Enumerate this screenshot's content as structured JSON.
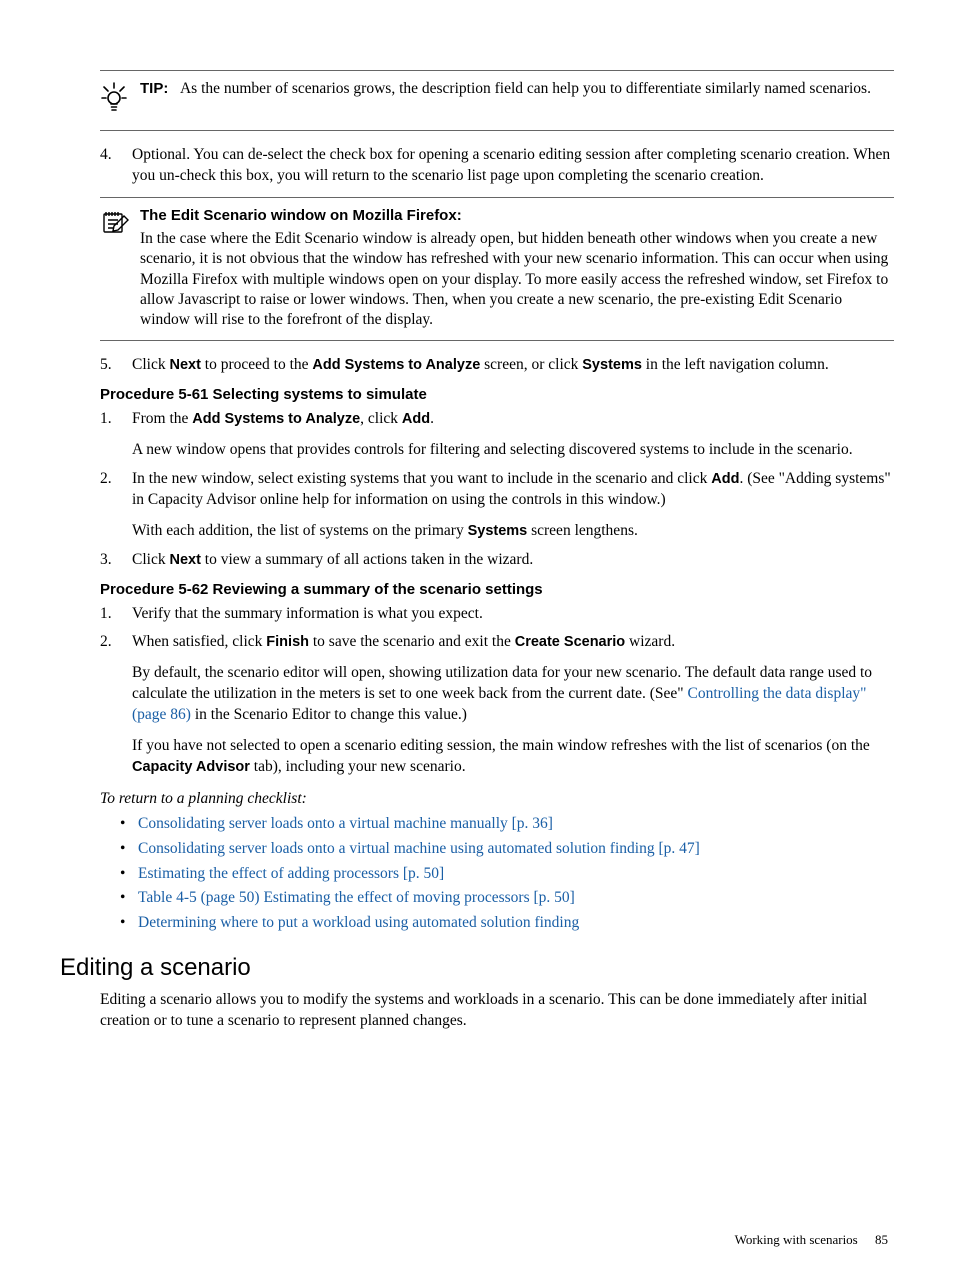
{
  "tip": {
    "label": "TIP:",
    "text": "As the number of scenarios grows, the description field can help you to differentiate similarly named scenarios."
  },
  "step4": {
    "num": "4.",
    "text": "Optional. You can de-select the check box for opening a scenario editing session after completing scenario creation. When you un-check this box, you will return to the scenario list page upon completing the scenario creation."
  },
  "note": {
    "title": "The Edit Scenario window on Mozilla Firefox:",
    "text": "In the case where the Edit Scenario window is already open, but hidden beneath other windows when you create a new scenario, it is not obvious that the window has refreshed with your new scenario information. This can occur when using Mozilla Firefox with multiple windows open on your display. To more easily access the refreshed window, set Firefox to allow Javascript to raise or lower windows. Then, when you create a new scenario, the pre-existing Edit Scenario window will rise to the forefront of the display."
  },
  "step5": {
    "num": "5.",
    "pre": "Click ",
    "b1": "Next",
    "mid1": " to proceed to the ",
    "b2": "Add Systems to Analyze",
    "mid2": " screen, or click ",
    "b3": "Systems",
    "post": " in the left navigation column."
  },
  "proc61": {
    "title": "Procedure 5-61 Selecting systems to simulate",
    "s1": {
      "num": "1.",
      "l1a": "From the ",
      "l1b": "Add Systems to Analyze",
      "l1c": ", click ",
      "l1d": "Add",
      "l1e": ".",
      "l2": "A new window opens that provides controls for filtering and selecting discovered systems to include in the scenario."
    },
    "s2": {
      "num": "2.",
      "l1a": "In the new window, select existing systems that you want to include in the scenario and click ",
      "l1b": "Add",
      "l1c": ". (See \"Adding systems\" in Capacity Advisor online help for information on using the controls in this window.)",
      "l2a": "With each addition, the list of systems on the primary ",
      "l2b": "Systems",
      "l2c": " screen lengthens."
    },
    "s3": {
      "num": "3.",
      "a": "Click ",
      "b": "Next",
      "c": " to view a summary of all actions taken in the wizard."
    }
  },
  "proc62": {
    "title": "Procedure 5-62 Reviewing a summary of the scenario settings",
    "s1": {
      "num": "1.",
      "text": "Verify that the summary information is what you expect."
    },
    "s2": {
      "num": "2.",
      "l1a": "When satisfied, click ",
      "l1b": "Finish",
      "l1c": " to save the scenario and exit the ",
      "l1d": "Create Scenario",
      "l1e": " wizard.",
      "l2a": "By default, the scenario editor will open, showing utilization data for your new scenario. The default data range used to calculate the utilization in the meters is set to one week back from the current date. (See\" ",
      "l2link": "Controlling the data display\" (page 86)",
      "l2b": " in the Scenario Editor to change this value.)",
      "l3a": "If you have not selected to open a scenario editing session, the main window refreshes with the list of scenarios (on the ",
      "l3b": "Capacity Advisor",
      "l3c": " tab), including your new scenario."
    }
  },
  "return": {
    "heading": "To return to a planning checklist:",
    "items": [
      "Consolidating server loads onto a virtual machine manually [p. 36]",
      "Consolidating server loads onto a virtual machine using automated solution finding [p. 47]",
      "Estimating the effect of adding processors [p. 50]",
      "Table 4-5 (page 50) Estimating the effect of moving processors [p. 50]",
      "Determining where to put a workload using automated solution finding"
    ]
  },
  "editing": {
    "heading": "Editing a scenario",
    "body": "Editing a scenario allows you to modify the systems and workloads in a scenario. This can be done immediately after initial creation or to tune a scenario to represent planned changes."
  },
  "footer": {
    "text": "Working with scenarios",
    "page": "85"
  }
}
